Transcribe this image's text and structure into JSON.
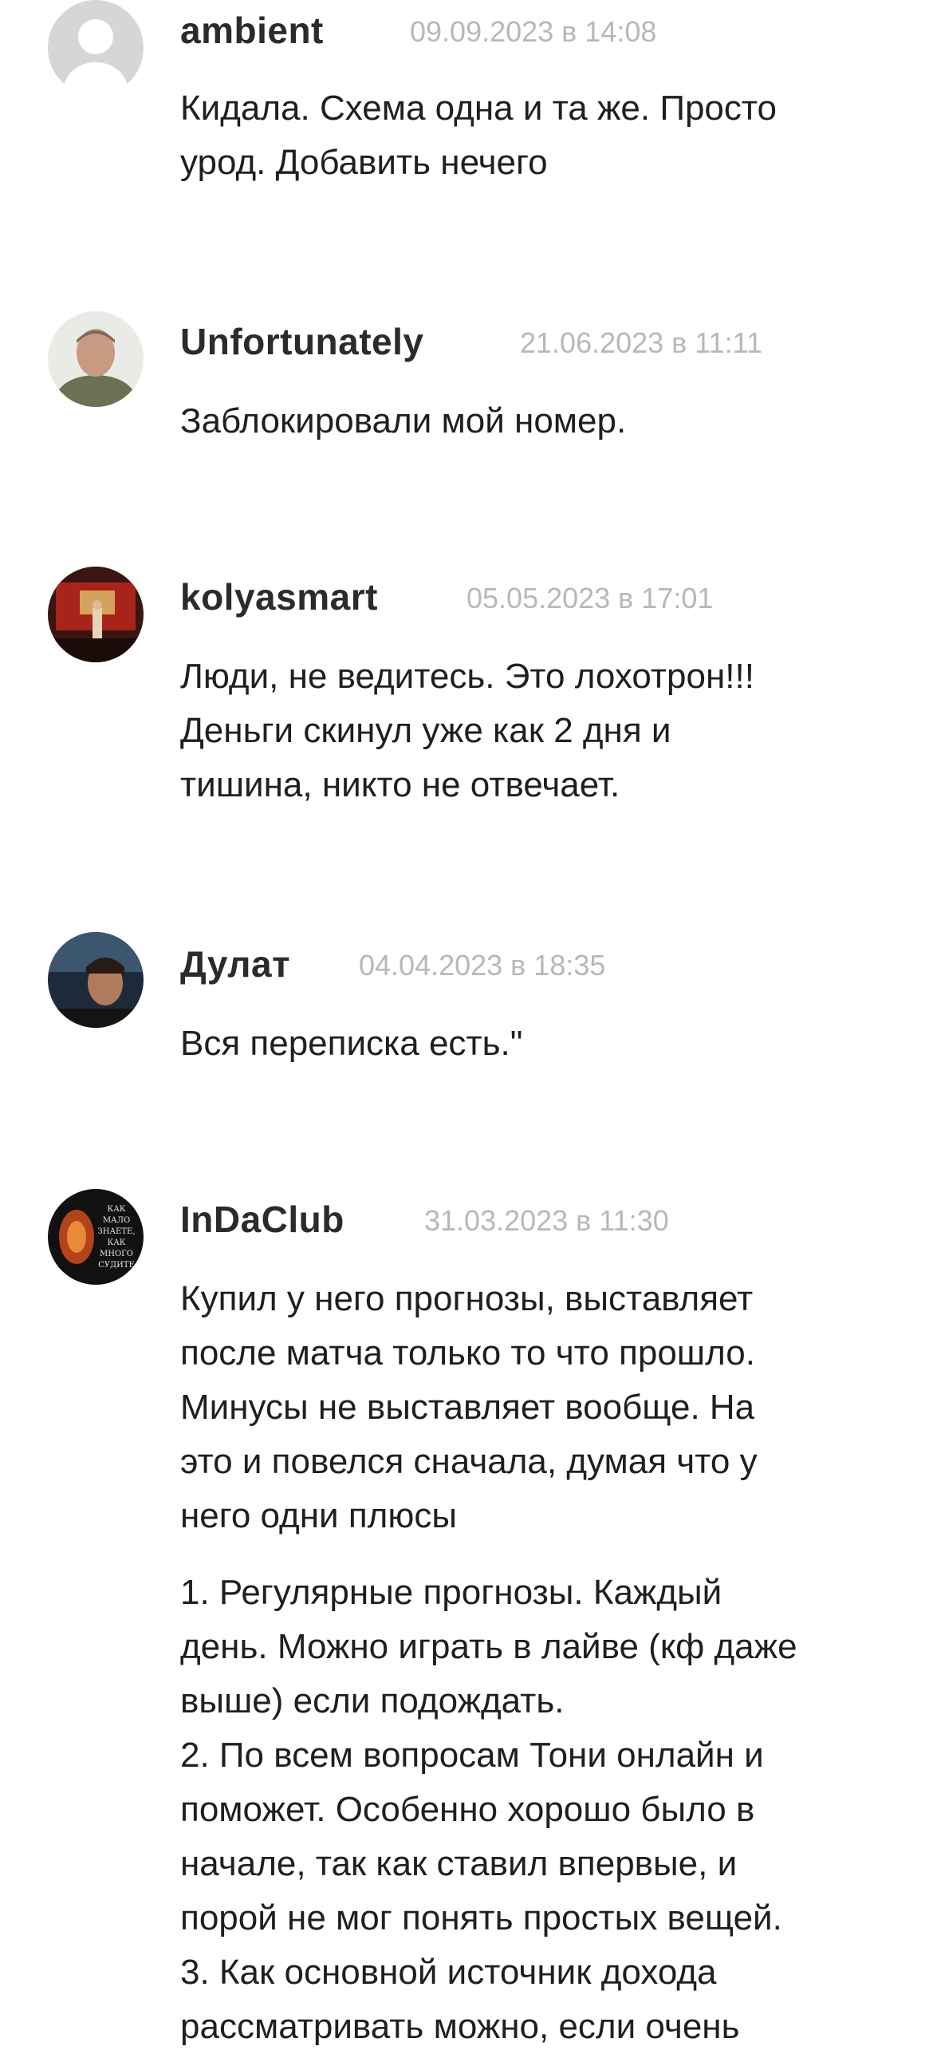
{
  "comments": [
    {
      "author": "ambient",
      "date": "09.09.2023 в 14:08",
      "paragraphs": [
        "Кидала. Схема одна и та же. Просто\nурод. Добавить нечего"
      ]
    },
    {
      "author": "Unfortunately",
      "date": "21.06.2023 в 11:11",
      "paragraphs": [
        "Заблокировали мой номер."
      ]
    },
    {
      "author": "kolyasmart",
      "date": "05.05.2023 в 17:01",
      "paragraphs": [
        "Люди, не ведитесь. Это лохотрон!!!\nДеньги скинул уже как 2 дня и\nтишина, никто не отвечает."
      ]
    },
    {
      "author": "Дулат",
      "date": "04.04.2023 в 18:35",
      "paragraphs": [
        "Вся переписка есть.\""
      ]
    },
    {
      "author": "InDaClub",
      "date": "31.03.2023 в 11:30",
      "avatar_text": [
        "КАК",
        "МАЛО",
        "ЗНАЕТЕ,",
        "КАК",
        "МНОГО",
        "СУДИТЕ"
      ],
      "paragraphs": [
        "Купил у него прогнозы, выставляет\nпосле матча только то что прошло.\nМинусы не выставляет вообще. На\nэто и повелся сначала, думая что у\nнего одни плюсы",
        "1. Регулярные прогнозы. Каждый\nдень. Можно играть в лайве (кф даже\nвыше) если подождать.\n2. По всем вопросам Тони онлайн и\nпоможет. Особенно хорошо было в\nначале, так как ставил впервые, и\nпорой не мог понять простых вещей.\n3. Как основной источник дохода\nрассматривать можно, если очень"
      ]
    }
  ]
}
